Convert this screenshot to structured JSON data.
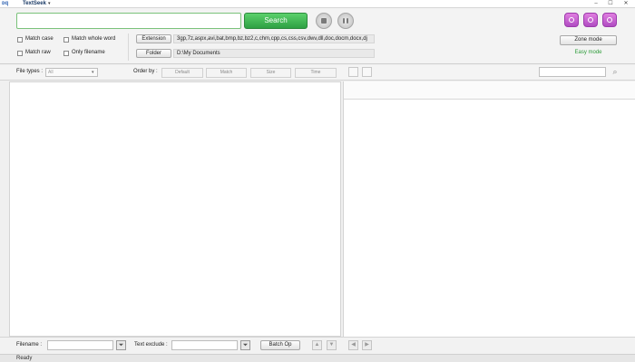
{
  "app": {
    "title": "TextSeek",
    "logo_text": "ᴅq"
  },
  "window": {
    "minimize": "–",
    "maximize": "☐",
    "close": "✕"
  },
  "search": {
    "value": "",
    "placeholder": "",
    "button_label": "Search"
  },
  "options": {
    "match_case": "Match case",
    "match_whole_word": "Match whole word",
    "match_raw": "Match raw",
    "only_filename": "Only filename"
  },
  "extension": {
    "button_label": "Extension",
    "value": "3gp,7z,aspx,avi,bat,bmp,bz,bz2,c,chm,cpp,cs,css,csv,dwv,dll,doc,docm,docx,dj"
  },
  "folder": {
    "button_label": "Folder",
    "value": "D:\\My Documents"
  },
  "modes": {
    "zone_mode": "Zone mode",
    "easy_mode": "Easy mode"
  },
  "filter": {
    "file_types_label": "File types :",
    "file_types_value": "All",
    "order_by_label": "Order by :",
    "order_options": [
      "Default",
      "Match",
      "Size",
      "Time"
    ]
  },
  "bottom": {
    "filename_label": "Filename :",
    "text_exclude_label": "Text exclude :",
    "batch_op_label": "Batch Op"
  },
  "status": {
    "text": "Ready"
  },
  "colors": {
    "accent_green": "#2ea043",
    "mode_purple": "#b04cc2"
  }
}
